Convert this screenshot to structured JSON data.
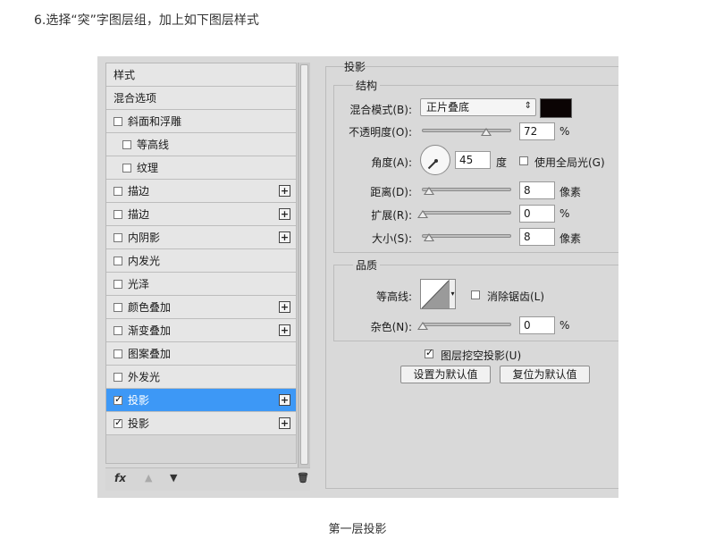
{
  "heading": "6.选择“突”字图层组，加上如下图层样式",
  "caption": "第一层投影",
  "styles_panel": {
    "header": "样式",
    "blend_options": "混合选项",
    "items": [
      {
        "label": "斜面和浮雕",
        "checked": false,
        "plus": false,
        "indent": false
      },
      {
        "label": "等高线",
        "checked": false,
        "plus": false,
        "indent": true
      },
      {
        "label": "纹理",
        "checked": false,
        "plus": false,
        "indent": true
      },
      {
        "label": "描边",
        "checked": false,
        "plus": true,
        "indent": false
      },
      {
        "label": "描边",
        "checked": false,
        "plus": true,
        "indent": false
      },
      {
        "label": "内阴影",
        "checked": false,
        "plus": true,
        "indent": false
      },
      {
        "label": "内发光",
        "checked": false,
        "plus": false,
        "indent": false
      },
      {
        "label": "光泽",
        "checked": false,
        "plus": false,
        "indent": false
      },
      {
        "label": "颜色叠加",
        "checked": false,
        "plus": true,
        "indent": false
      },
      {
        "label": "渐变叠加",
        "checked": false,
        "plus": true,
        "indent": false
      },
      {
        "label": "图案叠加",
        "checked": false,
        "plus": false,
        "indent": false
      },
      {
        "label": "外发光",
        "checked": false,
        "plus": false,
        "indent": false
      },
      {
        "label": "投影",
        "checked": true,
        "plus": true,
        "indent": false,
        "selected": true
      },
      {
        "label": "投影",
        "checked": true,
        "plus": true,
        "indent": false
      }
    ],
    "fx_label": "fx",
    "up_icon": "▲",
    "down_icon": "▼",
    "trash_icon": "🗑"
  },
  "drop_shadow": {
    "title": "投影",
    "structure": {
      "title": "结构",
      "blend_mode_label": "混合模式(B):",
      "blend_mode_value": "正片叠底",
      "shadow_color": "#0b0404",
      "opacity_label": "不透明度(O):",
      "opacity_value": "72",
      "opacity_unit": "%",
      "opacity_level": 0.72,
      "angle_label": "角度(A):",
      "angle_value": "45",
      "angle_unit": "度",
      "global_light_label": "使用全局光(G)",
      "global_light_checked": false,
      "distance_label": "距离(D):",
      "distance_value": "8",
      "distance_unit": "像素",
      "spread_label": "扩展(R):",
      "spread_value": "0",
      "spread_unit": "%",
      "size_label": "大小(S):",
      "size_value": "8",
      "size_unit": "像素"
    },
    "quality": {
      "title": "品质",
      "contour_label": "等高线:",
      "anti_alias_label": "消除锯齿(L)",
      "anti_alias_checked": false,
      "noise_label": "杂色(N):",
      "noise_value": "0",
      "noise_unit": "%"
    },
    "knockout_label": "图层挖空投影(U)",
    "knockout_checked": true,
    "make_default_label": "设置为默认值",
    "reset_default_label": "复位为默认值"
  }
}
